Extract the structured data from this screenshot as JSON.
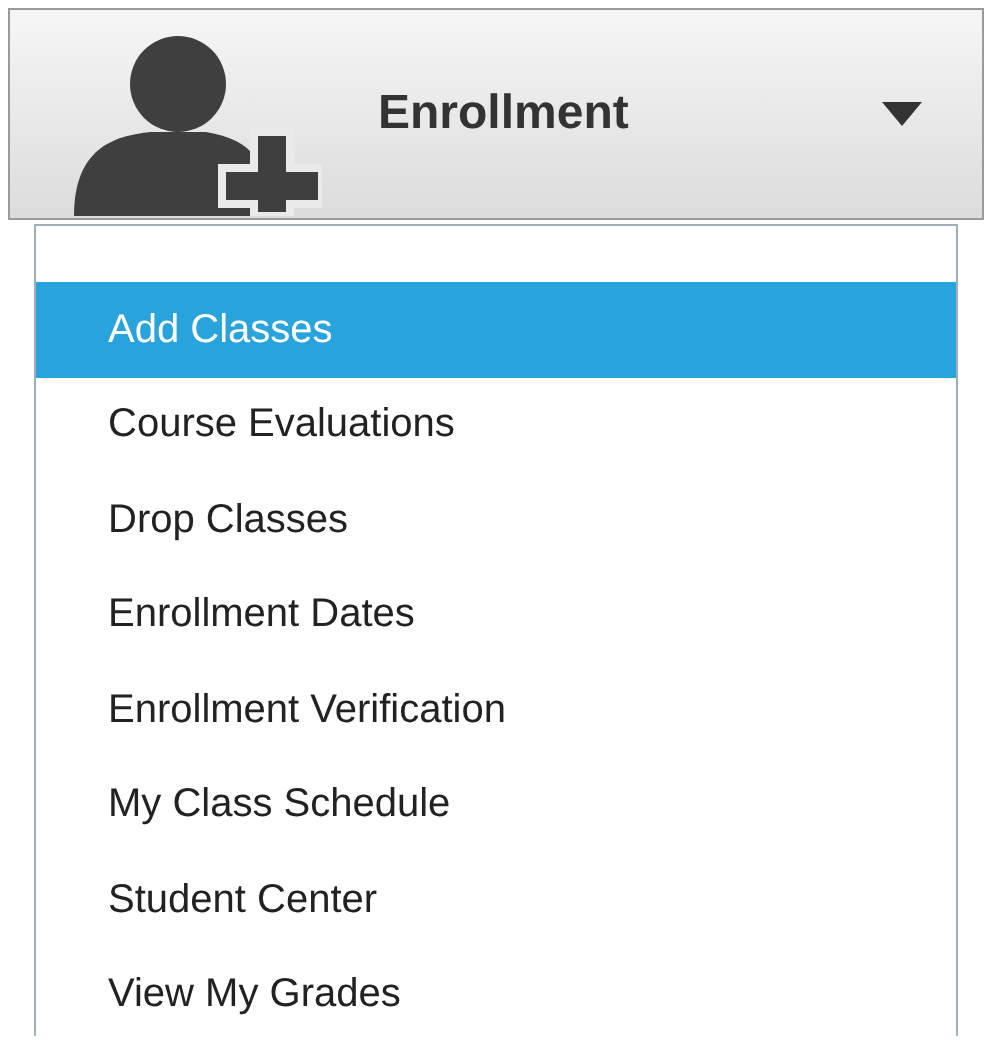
{
  "header": {
    "title": "Enrollment",
    "expanded": true
  },
  "menu": {
    "items": [
      {
        "label": "Add Classes",
        "selected": true
      },
      {
        "label": "Course Evaluations",
        "selected": false
      },
      {
        "label": "Drop Classes",
        "selected": false
      },
      {
        "label": "Enrollment Dates",
        "selected": false
      },
      {
        "label": "Enrollment Verification",
        "selected": false
      },
      {
        "label": "My Class Schedule",
        "selected": false
      },
      {
        "label": "Student Center",
        "selected": false
      },
      {
        "label": "View My Grades",
        "selected": false
      }
    ]
  }
}
